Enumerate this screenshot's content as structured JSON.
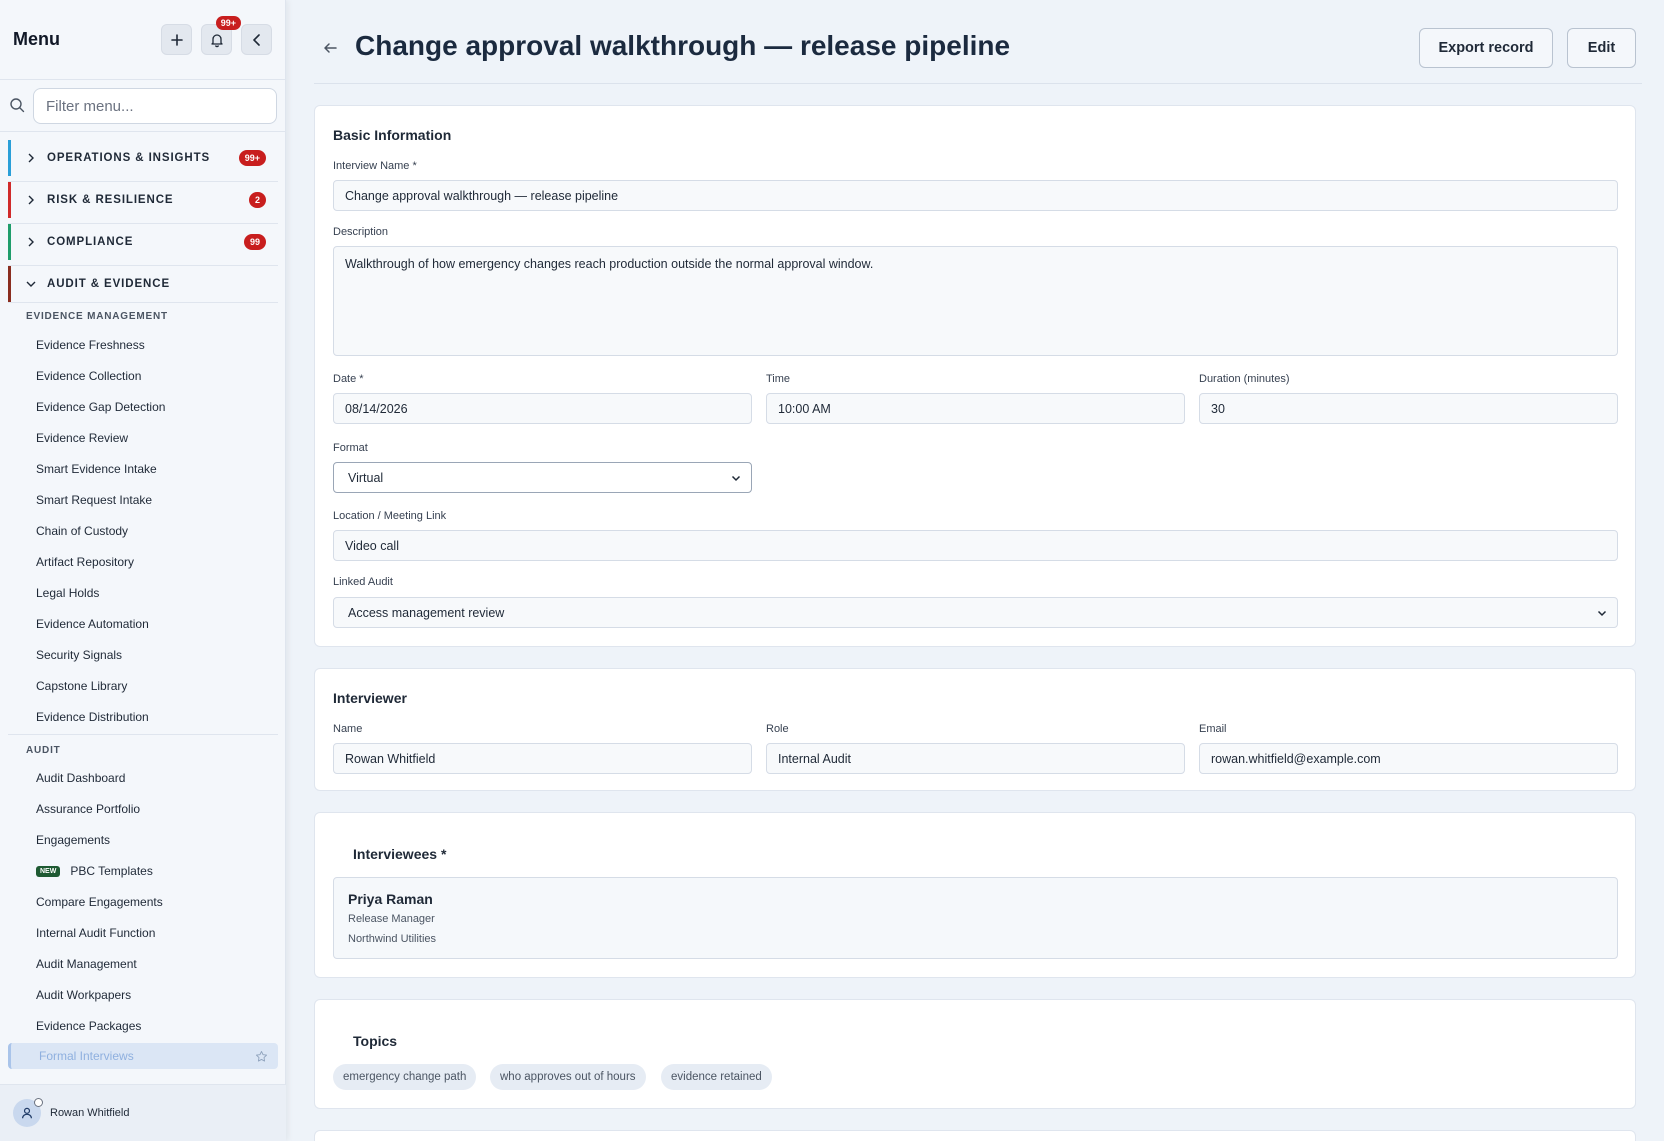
{
  "sidebar": {
    "title": "Menu",
    "notification_count": "99+",
    "search_placeholder": "Filter menu...",
    "sections": [
      {
        "label": "OPERATIONS & INSIGHTS",
        "badge": "99+",
        "color": "#2a9fd8"
      },
      {
        "label": "RISK & RESILIENCE",
        "badge": "2",
        "color": "#d02a2a"
      },
      {
        "label": "COMPLIANCE",
        "badge": "99",
        "color": "#1f9d6b"
      },
      {
        "label": "AUDIT & EVIDENCE",
        "badge": "",
        "color": "#8a2d1f"
      }
    ],
    "groups": {
      "evidence_management": "EVIDENCE MANAGEMENT",
      "audit": "AUDIT"
    },
    "evidence_items": [
      "Evidence Freshness",
      "Evidence Collection",
      "Evidence Gap Detection",
      "Evidence Review",
      "Smart Evidence Intake",
      "Smart Request Intake",
      "Chain of Custody",
      "Artifact Repository",
      "Legal Holds",
      "Evidence Automation",
      "Security Signals",
      "Capstone Library",
      "Evidence Distribution"
    ],
    "audit_items": [
      "Audit Dashboard",
      "Assurance Portfolio",
      "Engagements",
      "PBC Templates",
      "Compare Engagements",
      "Internal Audit Function",
      "Audit Management",
      "Audit Workpapers",
      "Evidence Packages"
    ],
    "new_badge": "NEW",
    "active_item": "Formal Interviews",
    "user_name": "Rowan Whitfield"
  },
  "header": {
    "title": "Change approval walkthrough — release pipeline",
    "export_label": "Export record",
    "edit_label": "Edit"
  },
  "basic": {
    "title": "Basic Information",
    "name_label": "Interview Name *",
    "name_value": "Change approval walkthrough — release pipeline",
    "description_label": "Description",
    "description_value": "Walkthrough of how emergency changes reach production outside the normal approval window.",
    "date_label": "Date *",
    "date_value": "08/14/2026",
    "time_label": "Time",
    "time_value": "10:00  AM",
    "duration_label": "Duration (minutes)",
    "duration_value": "30",
    "format_label": "Format",
    "format_value": "Virtual",
    "location_label": "Location / Meeting Link",
    "location_value": "Video call",
    "linked_audit_label": "Linked Audit",
    "linked_audit_value": "Access management review"
  },
  "interviewer": {
    "title": "Interviewer",
    "name_label": "Name",
    "name_value": "Rowan Whitfield",
    "role_label": "Role",
    "role_value": "Internal Audit",
    "email_label": "Email",
    "email_value": "rowan.whitfield@example.com"
  },
  "interviewees": {
    "title": "Interviewees *",
    "people": [
      {
        "name": "Priya Raman",
        "role": "Release Manager",
        "org": "Northwind Utilities"
      }
    ]
  },
  "topics": {
    "title": "Topics",
    "tags": [
      "emergency change path",
      "who approves out of hours",
      "evidence retained"
    ]
  }
}
